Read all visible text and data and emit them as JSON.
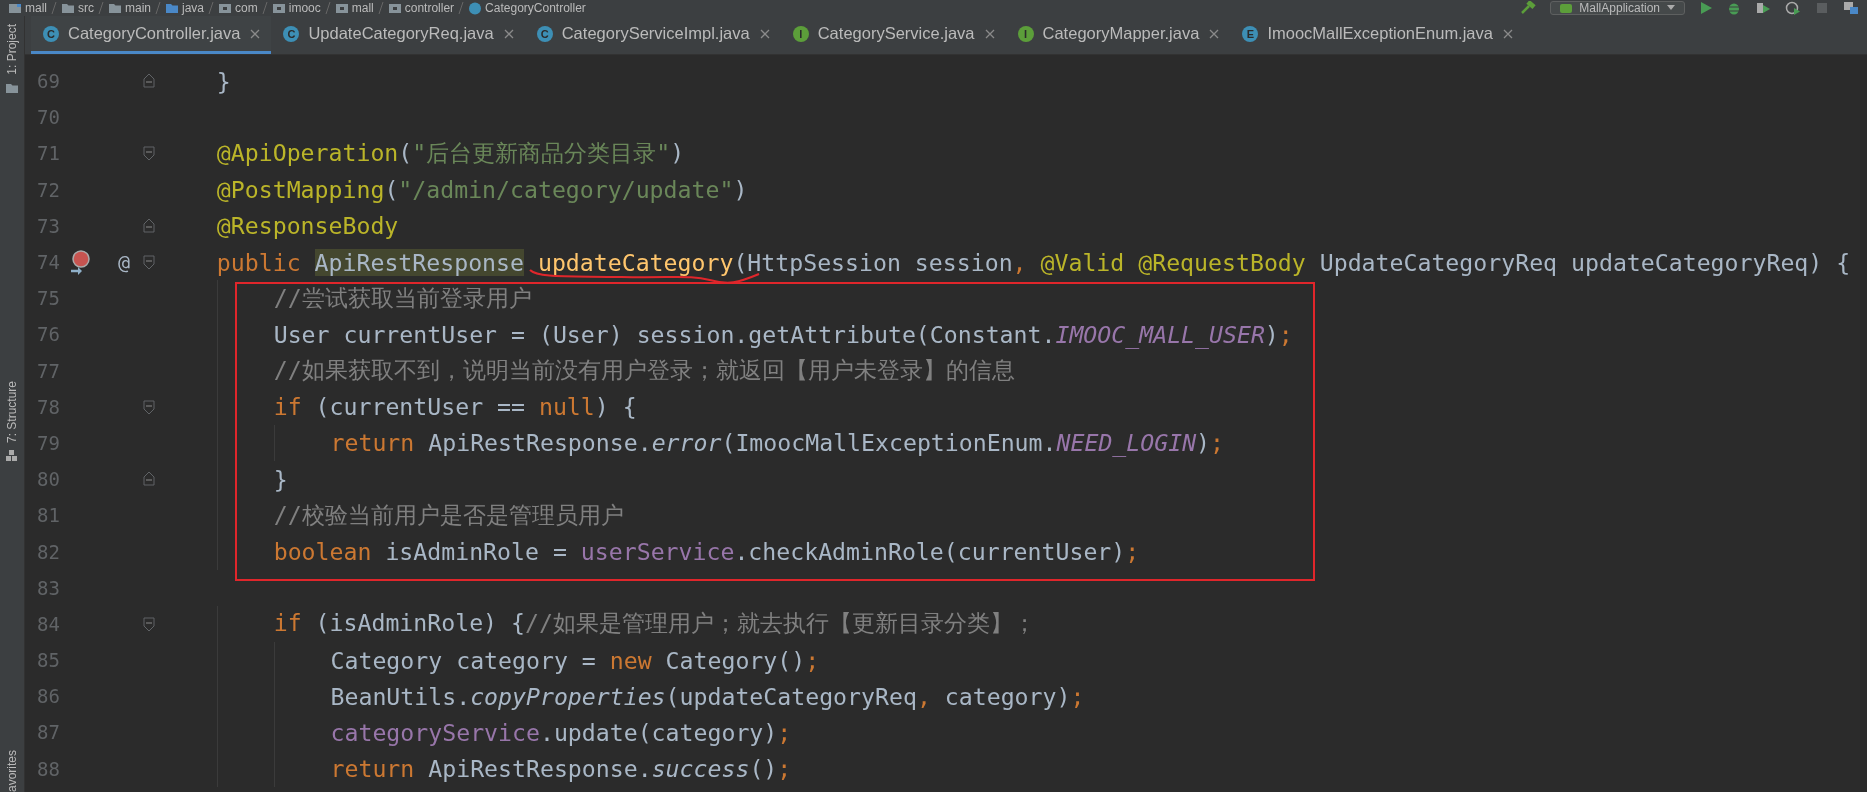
{
  "breadcrumb": [
    {
      "label": "mall",
      "kind": "module"
    },
    {
      "label": "src",
      "kind": "folder"
    },
    {
      "label": "main",
      "kind": "folder"
    },
    {
      "label": "java",
      "kind": "source"
    },
    {
      "label": "com",
      "kind": "package"
    },
    {
      "label": "imooc",
      "kind": "package"
    },
    {
      "label": "mall",
      "kind": "package"
    },
    {
      "label": "controller",
      "kind": "package"
    },
    {
      "label": "CategoryController",
      "kind": "class"
    }
  ],
  "run_config": {
    "label": "MallApplication"
  },
  "side_tabs": [
    {
      "label": "1: Project",
      "kind": "project"
    },
    {
      "label": "7: Structure",
      "kind": "structure"
    },
    {
      "label": "avorites",
      "kind": "favorites"
    }
  ],
  "tabs": [
    {
      "label": "CategoryController.java",
      "badge": "C",
      "color": "#3d8fb5",
      "selected": true
    },
    {
      "label": "UpdateCategoryReq.java",
      "badge": "C",
      "color": "#3d8fb5",
      "selected": false
    },
    {
      "label": "CategoryServiceImpl.java",
      "badge": "C",
      "color": "#3d8fb5",
      "selected": false
    },
    {
      "label": "CategoryService.java",
      "badge": "I",
      "color": "#5c9e3a",
      "selected": false
    },
    {
      "label": "CategoryMapper.java",
      "badge": "I",
      "color": "#5c9e3a",
      "selected": false
    },
    {
      "label": "ImoocMallExceptionEnum.java",
      "badge": "E",
      "color": "#3d8fb5",
      "selected": false
    }
  ],
  "editor": {
    "blocks": [
      {
        "boxed": false,
        "lines": [
          {
            "number": "69",
            "fold": {
              "kind": "end"
            },
            "tokens": [
              {
                "text": "    }",
                "kind": "plain"
              }
            ]
          },
          {
            "number": "70"
          },
          {
            "number": "71",
            "fold": {
              "kind": "start"
            },
            "tokens": [
              {
                "text": "    @ApiOperation",
                "kind": "annotation"
              },
              {
                "text": "(",
                "kind": "plain"
              },
              {
                "text": "\"后台更新商品分类目录\"",
                "kind": "string"
              },
              {
                "text": ")",
                "kind": "plain"
              }
            ]
          },
          {
            "number": "72",
            "tokens": [
              {
                "text": "    @PostMapping",
                "kind": "annotation"
              },
              {
                "text": "(",
                "kind": "plain"
              },
              {
                "text": "\"/admin/category/update\"",
                "kind": "string"
              },
              {
                "text": ")",
                "kind": "plain"
              }
            ]
          },
          {
            "number": "73",
            "fold": {
              "kind": "end"
            },
            "tokens": [
              {
                "text": "    @ResponseBody",
                "kind": "annotation"
              }
            ]
          },
          {
            "number": "74",
            "fold": {
              "kind": "start"
            },
            "gutter_icon": {
              "kind": "override"
            },
            "mark": "@",
            "tokens": [
              {
                "text": "    public ",
                "kind": "keyword"
              },
              {
                "text": "ApiRestResponse",
                "kind": "usage"
              },
              {
                "text": " updateCategory",
                "kind": "method_decl",
                "underline": {
                  "kind": "squiggle"
                }
              },
              {
                "text": "(HttpSession session",
                "kind": "plain"
              },
              {
                "text": ", ",
                "kind": "keyword"
              },
              {
                "text": "@Valid @RequestBody",
                "kind": "annotation"
              },
              {
                "text": " UpdateCategoryReq updateCategoryReq) {",
                "kind": "plain"
              }
            ]
          }
        ]
      },
      {
        "boxed": true,
        "lines": [
          {
            "number": "75",
            "tokens": [
              {
                "text": "        //尝试获取当前登录用户",
                "kind": "comment"
              }
            ]
          },
          {
            "number": "76",
            "tokens": [
              {
                "text": "        User currentUser = (User) session.getAttribute(Constant.",
                "kind": "plain"
              },
              {
                "text": "IMOOC_MALL_USER",
                "kind": "const"
              },
              {
                "text": ")",
                "kind": "plain"
              },
              {
                "text": ";",
                "kind": "keyword"
              }
            ]
          },
          {
            "number": "77",
            "tokens": [
              {
                "text": "        //如果获取不到，说明当前没有用户登录；就返回【用户未登录】的信息",
                "kind": "comment"
              }
            ]
          },
          {
            "number": "78",
            "fold": {
              "kind": "start"
            },
            "tokens": [
              {
                "text": "        if ",
                "kind": "keyword"
              },
              {
                "text": "(currentUser == ",
                "kind": "plain"
              },
              {
                "text": "null",
                "kind": "keyword"
              },
              {
                "text": ") {",
                "kind": "plain"
              }
            ]
          },
          {
            "number": "79",
            "tokens": [
              {
                "text": "            return ",
                "kind": "keyword"
              },
              {
                "text": "ApiRestResponse.",
                "kind": "plain"
              },
              {
                "text": "error",
                "kind": "static_call"
              },
              {
                "text": "(ImoocMallExceptionEnum.",
                "kind": "plain"
              },
              {
                "text": "NEED_LOGIN",
                "kind": "const"
              },
              {
                "text": ")",
                "kind": "plain"
              },
              {
                "text": ";",
                "kind": "keyword"
              }
            ]
          },
          {
            "number": "80",
            "fold": {
              "kind": "end"
            },
            "tokens": [
              {
                "text": "        }",
                "kind": "plain"
              }
            ]
          },
          {
            "number": "81",
            "tokens": [
              {
                "text": "        //校验当前用户是否是管理员用户",
                "kind": "comment"
              }
            ]
          },
          {
            "number": "82",
            "tokens": [
              {
                "text": "        boolean ",
                "kind": "keyword"
              },
              {
                "text": "isAdminRole = ",
                "kind": "plain"
              },
              {
                "text": "userService",
                "kind": "field"
              },
              {
                "text": ".checkAdminRole(currentUser)",
                "kind": "plain"
              },
              {
                "text": ";",
                "kind": "keyword"
              }
            ]
          }
        ]
      },
      {
        "boxed": false,
        "lines": [
          {
            "number": "83"
          },
          {
            "number": "84",
            "fold": {
              "kind": "start"
            },
            "tokens": [
              {
                "text": "        if ",
                "kind": "keyword"
              },
              {
                "text": "(isAdminRole) {",
                "kind": "plain"
              },
              {
                "text": "//如果是管理用户；就去执行【更新目录分类】；",
                "kind": "comment"
              }
            ]
          },
          {
            "number": "85",
            "tokens": [
              {
                "text": "            Category category = ",
                "kind": "plain"
              },
              {
                "text": "new ",
                "kind": "keyword"
              },
              {
                "text": "Category()",
                "kind": "plain"
              },
              {
                "text": ";",
                "kind": "keyword"
              }
            ]
          },
          {
            "number": "86",
            "tokens": [
              {
                "text": "            BeanUtils.",
                "kind": "plain"
              },
              {
                "text": "copyProperties",
                "kind": "static_call"
              },
              {
                "text": "(updateCategoryReq",
                "kind": "plain"
              },
              {
                "text": ", ",
                "kind": "keyword"
              },
              {
                "text": "category)",
                "kind": "plain"
              },
              {
                "text": ";",
                "kind": "keyword"
              }
            ]
          },
          {
            "number": "87",
            "tokens": [
              {
                "text": "            categoryService",
                "kind": "field"
              },
              {
                "text": ".update(category)",
                "kind": "plain"
              },
              {
                "text": ";",
                "kind": "keyword"
              }
            ]
          },
          {
            "number": "88",
            "tokens": [
              {
                "text": "            return ",
                "kind": "keyword"
              },
              {
                "text": "ApiRestResponse.",
                "kind": "plain"
              },
              {
                "text": "success",
                "kind": "static_call"
              },
              {
                "text": "()",
                "kind": "plain"
              },
              {
                "text": ";",
                "kind": "keyword"
              }
            ]
          }
        ]
      }
    ]
  }
}
